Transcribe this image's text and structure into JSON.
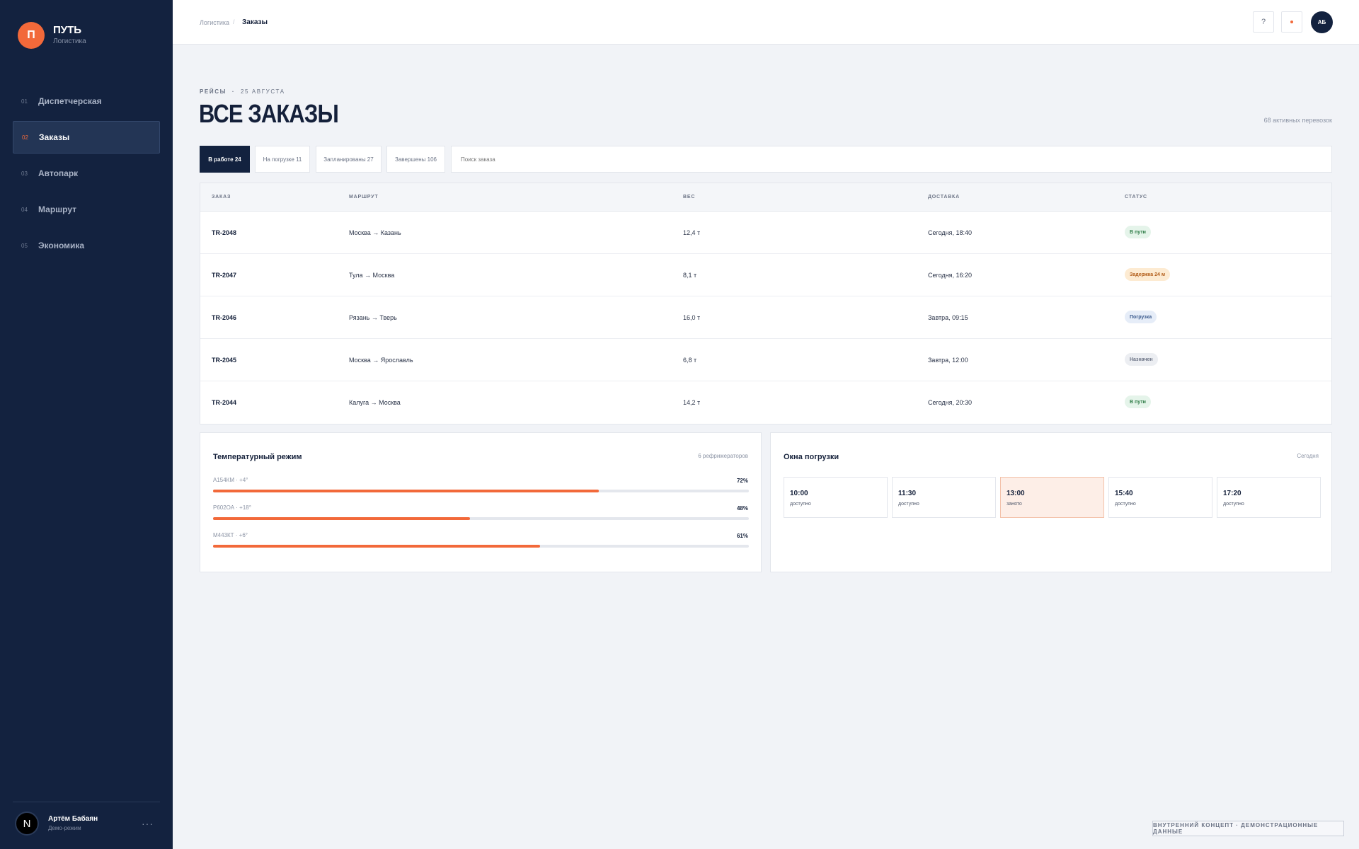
{
  "brand": {
    "initial": "П",
    "title": "ПУТЬ",
    "subtitle": "Логистика"
  },
  "nav": [
    {
      "num": "01",
      "label": "Диспетчерская",
      "active": false
    },
    {
      "num": "02",
      "label": "Заказы",
      "active": true
    },
    {
      "num": "03",
      "label": "Автопарк",
      "active": false
    },
    {
      "num": "04",
      "label": "Маршрут",
      "active": false
    },
    {
      "num": "05",
      "label": "Экономика",
      "active": false
    }
  ],
  "user": {
    "initial": "N",
    "name": "Артём Бабаян",
    "role": "Демо-режим",
    "more": "···"
  },
  "header": {
    "breadcrumb": [
      "Логистика",
      "Заказы"
    ],
    "separator": "/",
    "help_label": "?",
    "avatar_initials": "АБ"
  },
  "page": {
    "eyebrow": "РЕЙСЫ",
    "eyebrow_sep": "·",
    "eyebrow_date": "25 АВГУСТА",
    "title": "ВСЕ ЗАКАЗЫ",
    "active_count": "68 активных перевозок"
  },
  "tabs": [
    "В работе 24",
    "На погрузке 11",
    "Запланированы 27",
    "Завершены 106"
  ],
  "search": {
    "placeholder": "Поиск заказа"
  },
  "table": {
    "columns": [
      "ЗАКАЗ",
      "МАРШРУТ",
      "ВЕС",
      "ДОСТАВКА",
      "СТАТУС"
    ],
    "rows": [
      {
        "id": "TR-2048",
        "route": "Москва → Казань",
        "weight": "12,4 т",
        "delivery": "Сегодня, 18:40",
        "status": "В пути",
        "status_type": "green"
      },
      {
        "id": "TR-2047",
        "route": "Тула → Москва",
        "weight": "8,1 т",
        "delivery": "Сегодня, 16:20",
        "status": "Задержка 24 м",
        "status_type": "amber"
      },
      {
        "id": "TR-2046",
        "route": "Рязань → Тверь",
        "weight": "16,0 т",
        "delivery": "Завтра, 09:15",
        "status": "Погрузка",
        "status_type": "blue"
      },
      {
        "id": "TR-2045",
        "route": "Москва → Ярославль",
        "weight": "6,8 т",
        "delivery": "Завтра, 12:00",
        "status": "Назначен",
        "status_type": "gray"
      },
      {
        "id": "TR-2044",
        "route": "Калуга → Москва",
        "weight": "14,2 т",
        "delivery": "Сегодня, 20:30",
        "status": "В пути",
        "status_type": "green"
      }
    ]
  },
  "temperature": {
    "title": "Температурный режим",
    "meta": "6 рефрижераторов",
    "items": [
      {
        "label": "А154КМ · +4°",
        "value": "72%",
        "fraction": 0.72
      },
      {
        "label": "Р602ОА · +18°",
        "value": "48%",
        "fraction": 0.48
      },
      {
        "label": "М443КТ · +6°",
        "value": "61%",
        "fraction": 0.61
      }
    ]
  },
  "loading": {
    "title": "Окна погрузки",
    "meta": "Сегодня",
    "slots": [
      {
        "time": "10:00",
        "state": "доступно",
        "taken": false
      },
      {
        "time": "11:30",
        "state": "доступно",
        "taken": false
      },
      {
        "time": "13:00",
        "state": "занято",
        "taken": true
      },
      {
        "time": "15:40",
        "state": "доступно",
        "taken": false
      },
      {
        "time": "17:20",
        "state": "доступно",
        "taken": false
      }
    ]
  },
  "footer": {
    "tag": "ВНУТРЕННИЙ КОНЦЕПТ · ДЕМОНСТРАЦИОННЫЕ ДАННЫЕ"
  },
  "colors": {
    "sidebar": "#13223f",
    "accent": "#f2693a",
    "background": "#f1f3f7"
  }
}
